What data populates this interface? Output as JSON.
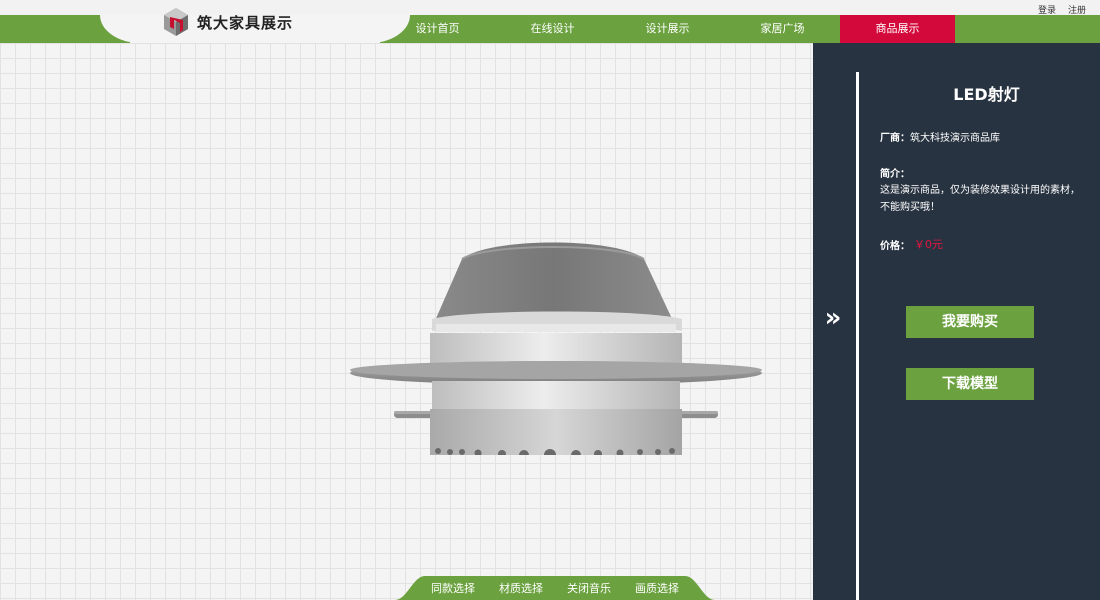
{
  "top_links": {
    "login": "登录",
    "register": "注册"
  },
  "brand": {
    "name": "筑大家具展示"
  },
  "nav": [
    {
      "label": "设计首页"
    },
    {
      "label": "在线设计"
    },
    {
      "label": "设计展示"
    },
    {
      "label": "家居广场"
    },
    {
      "label": "商品展示",
      "active": true
    }
  ],
  "toolbar": {
    "items": [
      {
        "label": "同款选择"
      },
      {
        "label": "材质选择"
      },
      {
        "label": "关闭音乐"
      },
      {
        "label": "画质选择"
      }
    ]
  },
  "product": {
    "title": "LED射灯",
    "maker_label": "厂商：",
    "maker": "筑大科技演示商品库",
    "intro_label": "简介：",
    "intro": "这是演示商品，仅为装修效果设计用的素材，不能购买哦！",
    "price_label": "价格：",
    "price": "￥0元"
  },
  "actions": {
    "buy": "我要购买",
    "download": "下载模型"
  },
  "panel": {
    "collapse_icon": "double-chevron-right-icon"
  },
  "colors": {
    "accent_green": "#6ba13f",
    "active_red": "#d4093b",
    "panel_bg": "#283341",
    "price_red": "#e0163f"
  }
}
